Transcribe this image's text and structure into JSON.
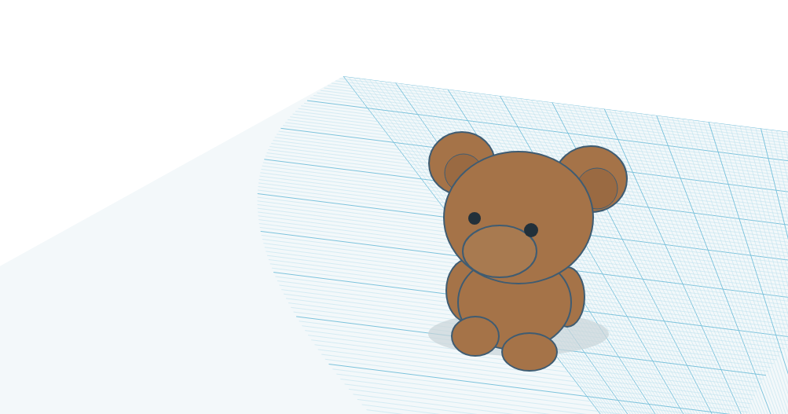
{
  "viewport": {
    "workplane": {
      "visible": true
    },
    "model": {
      "kind": "bear"
    }
  }
}
